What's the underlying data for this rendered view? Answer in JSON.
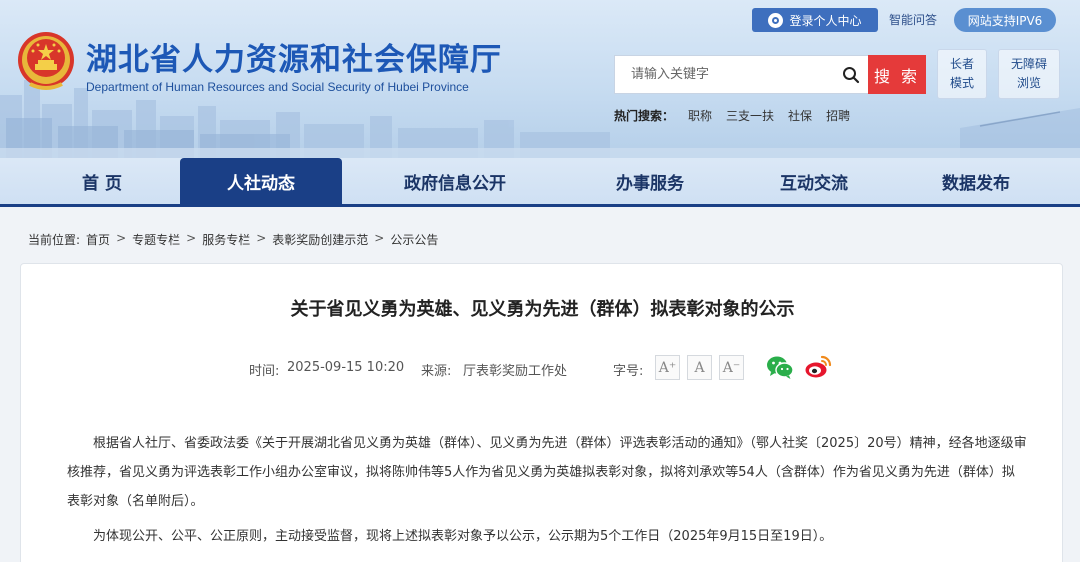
{
  "header": {
    "site_title": "湖北省人力资源和社会保障厅",
    "site_subtitle": "Department of Human Resources and Social Security of Hubei Province",
    "login_label": "登录个人中心",
    "qa_label": "智能问答",
    "ipv6_label": "网站支持IPV6",
    "search": {
      "placeholder": "请输入关键字",
      "button_label": "搜 索"
    },
    "elder_mode": [
      "长者",
      "模式"
    ],
    "accessible_mode": [
      "无障碍",
      "浏览"
    ],
    "hot_search": {
      "label": "热门搜索：",
      "items": [
        "职称",
        "三支一扶",
        "社保",
        "招聘"
      ]
    },
    "colors": {
      "brand_blue": "#1d58b6",
      "nav_dark": "#1a3f86",
      "search_red": "#e53a3a"
    }
  },
  "nav": {
    "items": [
      "首 页",
      "人社动态",
      "政府信息公开",
      "办事服务",
      "互动交流",
      "数据发布"
    ],
    "active_index": 1
  },
  "breadcrumb": {
    "label": "当前位置:",
    "items": [
      "首页",
      "专题专栏",
      "服务专栏",
      "表彰奖励创建示范",
      "公示公告"
    ],
    "separator": ">"
  },
  "article": {
    "title": "关于省见义勇为英雄、见义勇为先进（群体）拟表彰对象的公示",
    "time_label": "时间:",
    "time_value": "2025-09-15 10:20",
    "source_label": "来源:",
    "source_value": "厅表彰奖励工作处",
    "font_label": "字号:",
    "font_buttons": [
      "A⁺",
      "A",
      "A⁻"
    ],
    "share_icons": [
      "wechat-icon",
      "weibo-icon"
    ],
    "paragraphs": [
      "根据省人社厅、省委政法委《关于开展湖北省见义勇为英雄（群体）、见义勇为先进（群体）评选表彰活动的通知》（鄂人社奖〔2025〕20号）精神，经各地逐级审核推荐，省见义勇为评选表彰工作小组办公室审议，拟将陈帅伟等5人作为省见义勇为英雄拟表彰对象，拟将刘承欢等54人（含群体）作为省见义勇为先进（群体）拟表彰对象（名单附后）。",
      "为体现公开、公平、公正原则，主动接受监督，现将上述拟表彰对象予以公示，公示期为5个工作日（2025年9月15日至19日）。"
    ]
  }
}
